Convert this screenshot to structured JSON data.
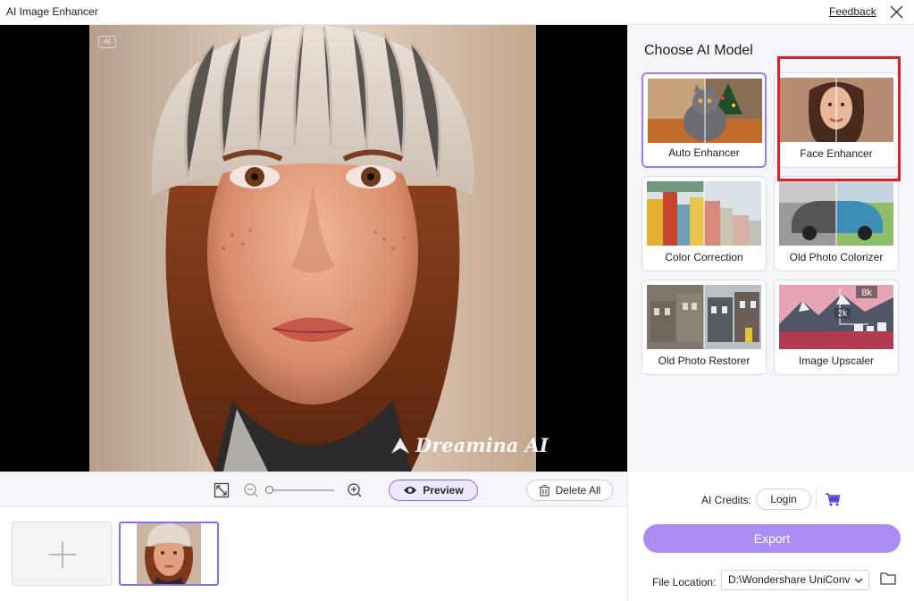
{
  "window": {
    "title": "AI Image Enhancer",
    "feedback_label": "Feedback"
  },
  "preview": {
    "ai_badge": "AI",
    "watermark_text": "Dreamina AI"
  },
  "toolbar": {
    "preview_label": "Preview",
    "delete_all_label": "Delete All"
  },
  "models": {
    "heading": "Choose AI Model",
    "items": [
      {
        "label": "Auto Enhancer",
        "selected": true
      },
      {
        "label": "Face Enhancer",
        "selected": false,
        "highlighted": true
      },
      {
        "label": "Color Correction",
        "selected": false
      },
      {
        "label": "Old Photo Colorizer",
        "selected": false
      },
      {
        "label": "Old Photo Restorer",
        "selected": false
      },
      {
        "label": "Image Upscaler",
        "selected": false
      }
    ],
    "upscaler_marks": [
      "8k",
      "2k"
    ]
  },
  "footer": {
    "credits_label": "AI Credits:",
    "login_label": "Login",
    "export_label": "Export",
    "file_location_label": "File Location:",
    "file_location_value": "D:\\Wondershare UniConv"
  },
  "colors": {
    "accent": "#8c6cf0",
    "export_button": "#a98df3",
    "highlight": "#e41c2a",
    "panel_bg": "#f5f6fa"
  }
}
